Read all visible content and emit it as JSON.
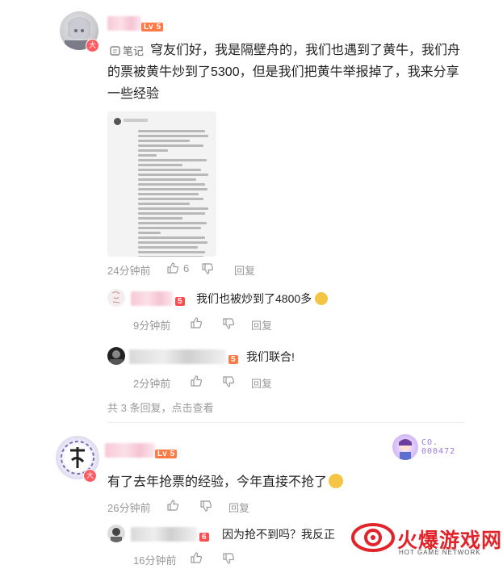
{
  "comment1": {
    "level": "5",
    "level_prefix": "Lv",
    "note_tag": "笔记",
    "badge": "大",
    "text_line1": "穹友们好，我是隔壁舟的，我们也遇到了黄牛，我们舟",
    "text_line2": "的票被黄牛炒到了5300，但是我们把黄牛举报掉了，我来分享",
    "text_line3": "一些经验",
    "time": "24分钟前",
    "likes": "6",
    "reply_label": "回复",
    "replies": [
      {
        "level": "5",
        "text": "我们也被炒到了4800多",
        "time": "9分钟前",
        "reply_label": "回复"
      },
      {
        "level": "5",
        "text": "我们联合!",
        "time": "2分钟前",
        "reply_label": "回复"
      }
    ],
    "view_more": "共 3 条回复，点击查看"
  },
  "comment2": {
    "level": "5",
    "level_prefix": "Lv",
    "badge": "大",
    "side_label": "CO.\n000472",
    "text": "有了去年抢票的经验，今年直接不抢了",
    "time": "26分钟前",
    "reply_label": "回复",
    "replies": [
      {
        "level": "6",
        "text": "因为抢不到吗？我反正",
        "time": "16分钟前"
      }
    ]
  },
  "watermark": {
    "title": "火爆游戏网",
    "subtitle": "HOT GAME NETWORK"
  },
  "colors": {
    "accent": "#e2232a",
    "pink": "#f7c9d6",
    "meta": "#999999"
  }
}
